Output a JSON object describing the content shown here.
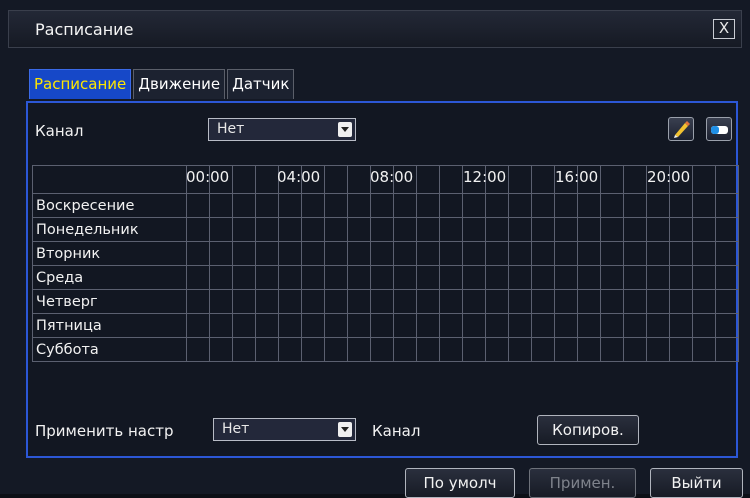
{
  "window": {
    "title": "Расписание",
    "close_label": "X"
  },
  "tabs": [
    {
      "label": "Расписание",
      "active": true
    },
    {
      "label": "Движение",
      "active": false
    },
    {
      "label": "Датчик",
      "active": false
    }
  ],
  "channel": {
    "label": "Канал",
    "value": "Нет"
  },
  "tools": {
    "draw": "pencil-icon",
    "erase": "eraser-icon"
  },
  "schedule": {
    "hour_labels": [
      "00:00",
      "04:00",
      "08:00",
      "12:00",
      "16:00",
      "20:00"
    ],
    "days": [
      "Воскресение",
      "Понедельник",
      "Вторник",
      "Среда",
      "Четверг",
      "Пятница",
      "Суббота"
    ],
    "slots_per_day": 24
  },
  "apply": {
    "label": "Применить настр",
    "value": "Нет",
    "channel_label": "Канал",
    "copy_button": "Копиров."
  },
  "footer": {
    "default_button": "По умолч",
    "apply_button": "Примен.",
    "exit_button": "Выйти"
  },
  "colors": {
    "accent": "#2c57d6",
    "active_tab_text": "#ffe600"
  }
}
